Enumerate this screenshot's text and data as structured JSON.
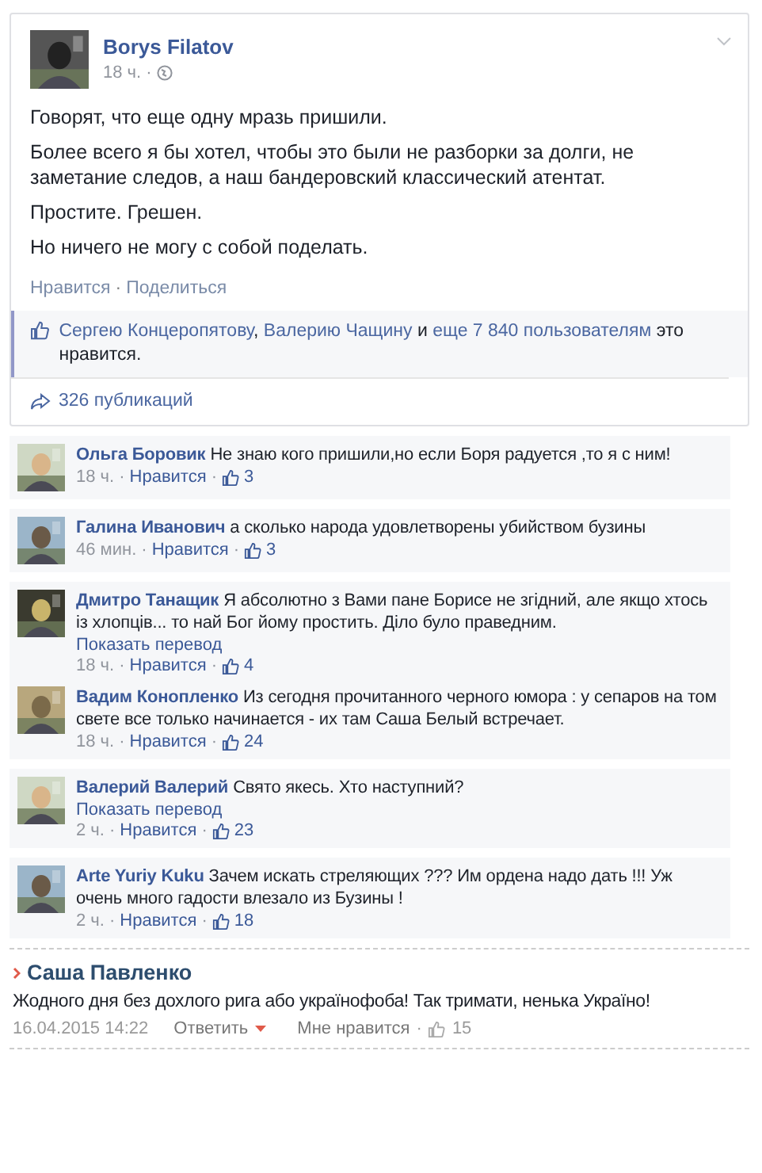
{
  "separator": "·",
  "post": {
    "author": "Borys Filatov",
    "time": "18 ч.",
    "paragraphs": [
      "Говорят, что еще одну мразь пришили.",
      "Более всего я бы хотел, чтобы это были не разборки за долги, не заметание следов, а наш бандеровский классический атентат.",
      "Простите. Грешен.",
      "Но ничего не могу с собой поделать."
    ],
    "actions": [
      "Нравится",
      "Поделиться"
    ],
    "likes_text": "**Сергею Концеропятову**, **Валерию Чащину** и **еще 7 840 пользователям** это нравится.",
    "shares": "326 публикаций"
  },
  "comment_groups": [
    [
      {
        "name": "Ольга Боровик",
        "text": "Не знаю кого пришили,но если Боря радуется ,то я с ним!",
        "time": "18 ч.",
        "like": "Нравится",
        "count": "3"
      }
    ],
    [
      {
        "name": "Галина Иванович",
        "text": "а сколько народа удовлетворены убийством бузины",
        "time": "46 мин.",
        "like": "Нравится",
        "count": "3"
      }
    ],
    [
      {
        "name": "Дмитро Танащик",
        "text": "Я абсолютно з Вами пане Борисе не згідний, але якщо хтось із хлопців... то най Бог йому простить. Діло було праведним.",
        "translate": "Показать перевод",
        "time": "18 ч.",
        "like": "Нравится",
        "count": "4"
      },
      {
        "name": "Вадим Конопленко",
        "text": "Из сегодня прочитанного черного юмора : у сепаров на том свете все только начинается - их там Саша Белый встречает.",
        "time": "18 ч.",
        "like": "Нравится",
        "count": "24"
      }
    ],
    [
      {
        "name": "Валерий Валерий",
        "text": "Свято якесь. Хто наступний?",
        "translate": "Показать перевод",
        "time": "2 ч.",
        "like": "Нравится",
        "count": "23"
      }
    ],
    [
      {
        "name": "Arte Yuriy Kuku",
        "text": "Зачем искать стреляющих ??? Им ордена надо дать !!! Уж очень много гадости влезало из Бузины !",
        "time": "2 ч.",
        "like": "Нравится",
        "count": "18"
      }
    ]
  ],
  "external_comment": {
    "name": "Саша Павленко",
    "text": "Жодного дня без дохлого рига або українофоба! Так тримати, ненька Україно!",
    "date": "16.04.2015 14:22",
    "reply": "Ответить",
    "like": "Мне нравится",
    "count": "15"
  }
}
